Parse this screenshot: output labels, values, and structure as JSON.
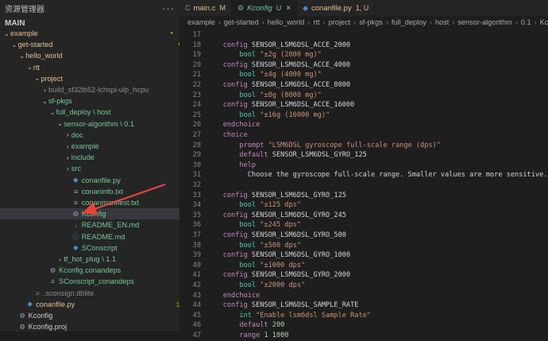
{
  "sidebar": {
    "title": "资源管理器",
    "more": "···",
    "section": "MAIN",
    "rows": [
      {
        "label": "example",
        "indent": 0,
        "chev": "⌄",
        "icon": "",
        "color": "#e2c08d",
        "status": "",
        "sc": "#cca700",
        "dot": true
      },
      {
        "label": "get-started",
        "indent": 1,
        "chev": "⌄",
        "icon": "",
        "color": "#e2c08d",
        "status": "",
        "sc": "#cca700",
        "dot": true
      },
      {
        "label": "hello_world",
        "indent": 2,
        "chev": "⌄",
        "icon": "",
        "color": "#e2c08d",
        "status": "",
        "sc": "#cca700",
        "dot": true
      },
      {
        "label": "rtt",
        "indent": 3,
        "chev": "⌄",
        "icon": "",
        "color": "#e2c08d",
        "status": "",
        "sc": "#cca700",
        "dot": true
      },
      {
        "label": "project",
        "indent": 4,
        "chev": "⌄",
        "icon": "",
        "color": "#e2c08d",
        "status": "",
        "sc": "#cca700",
        "dot": true
      },
      {
        "label": "build_sf32lb52-lchspi-ulp_hcpu",
        "indent": 5,
        "chev": "›",
        "icon": "",
        "color": "#8c8c8c",
        "status": "",
        "sc": "",
        "dot": false
      },
      {
        "label": "sf-pkgs",
        "indent": 5,
        "chev": "⌄",
        "icon": "",
        "color": "#73c991",
        "status": "",
        "sc": "#73c991",
        "dot": true
      },
      {
        "label": "full_deploy \\ host",
        "indent": 6,
        "chev": "⌄",
        "icon": "",
        "color": "#73c991",
        "status": "",
        "sc": "#73c991",
        "dot": true
      },
      {
        "label": "sensor-algorithm \\ 0.1",
        "indent": 7,
        "chev": "⌄",
        "icon": "",
        "color": "#73c991",
        "status": "",
        "sc": "#73c991",
        "dot": true
      },
      {
        "label": "doc",
        "indent": 8,
        "chev": "›",
        "icon": "",
        "color": "#73c991",
        "status": "",
        "sc": "#73c991",
        "dot": true
      },
      {
        "label": "example",
        "indent": 8,
        "chev": "›",
        "icon": "",
        "color": "#73c991",
        "status": "",
        "sc": "#73c991",
        "dot": true
      },
      {
        "label": "include",
        "indent": 8,
        "chev": "›",
        "icon": "",
        "color": "#73c991",
        "status": "",
        "sc": "#73c991",
        "dot": true
      },
      {
        "label": "src",
        "indent": 8,
        "chev": "›",
        "icon": "",
        "color": "#73c991",
        "status": "",
        "sc": "#73c991",
        "dot": true
      },
      {
        "label": "conanfile.py",
        "indent": 8,
        "chev": "",
        "icon": "◆",
        "ic": "#4b8bbe",
        "color": "#73c991",
        "status": "U",
        "sc": "#73c991",
        "dot": false
      },
      {
        "label": "conaninfo.txt",
        "indent": 8,
        "chev": "",
        "icon": "≡",
        "ic": "#9aa4af",
        "color": "#73c991",
        "status": "U",
        "sc": "#73c991",
        "dot": false
      },
      {
        "label": "conanmanifest.txt",
        "indent": 8,
        "chev": "",
        "icon": "≡",
        "ic": "#9aa4af",
        "color": "#73c991",
        "status": "U",
        "sc": "#73c991",
        "dot": false
      },
      {
        "label": "Kconfig",
        "indent": 8,
        "chev": "",
        "icon": "⚙",
        "ic": "#9aa4af",
        "color": "#73c991",
        "status": "U",
        "sc": "#73c991",
        "dot": false,
        "selected": true
      },
      {
        "label": "README_EN.md",
        "indent": 8,
        "chev": "",
        "icon": "↓",
        "ic": "#519aba",
        "color": "#73c991",
        "status": "U",
        "sc": "#73c991",
        "dot": false
      },
      {
        "label": "README.md",
        "indent": 8,
        "chev": "",
        "icon": "ⓘ",
        "ic": "#519aba",
        "color": "#73c991",
        "status": "U",
        "sc": "#73c991",
        "dot": false
      },
      {
        "label": "SConscript",
        "indent": 8,
        "chev": "",
        "icon": "◆",
        "ic": "#4b8bbe",
        "color": "#73c991",
        "status": "U",
        "sc": "#73c991",
        "dot": false
      },
      {
        "label": "tf_hot_plug \\ 1.1",
        "indent": 7,
        "chev": "›",
        "icon": "",
        "color": "#73c991",
        "status": "",
        "sc": "#73c991",
        "dot": true
      },
      {
        "label": "Kconfig.conandeps",
        "indent": 5,
        "chev": "",
        "icon": "⚙",
        "ic": "#9aa4af",
        "color": "#73c991",
        "status": "U",
        "sc": "#73c991",
        "dot": false
      },
      {
        "label": "SConscript_conandeps",
        "indent": 5,
        "chev": "",
        "icon": "≡",
        "ic": "#9aa4af",
        "color": "#73c991",
        "status": "U",
        "sc": "#73c991",
        "dot": false
      },
      {
        "label": ".sconsign.dblite",
        "indent": 3,
        "chev": "",
        "icon": "≡",
        "ic": "#6d8086",
        "color": "#8c8c8c",
        "status": "",
        "sc": "",
        "dot": false
      },
      {
        "label": "conanfile.py",
        "indent": 2,
        "chev": "",
        "icon": "◆",
        "ic": "#4b8bbe",
        "color": "#e2c08d",
        "status": "1, U",
        "sc": "#cca700",
        "dot": false
      },
      {
        "label": "Kconfig",
        "indent": 1,
        "chev": "",
        "icon": "⚙",
        "ic": "#9aa4af",
        "color": "#cccccc",
        "status": "",
        "sc": "",
        "dot": false
      },
      {
        "label": "Kconfig.proj",
        "indent": 1,
        "chev": "",
        "icon": "⚙",
        "ic": "#9aa4af",
        "color": "#cccccc",
        "status": "",
        "sc": "",
        "dot": false
      }
    ]
  },
  "tabs": [
    {
      "icon": "C",
      "ic": "#519aba",
      "label": "main.c",
      "status": "M",
      "color": "#e2c08d",
      "italic": false,
      "active": false
    },
    {
      "icon": "⚙",
      "ic": "#9aa4af",
      "label": "Kconfig",
      "status": "U",
      "color": "#73c991",
      "italic": true,
      "active": true,
      "close": "×"
    },
    {
      "icon": "◆",
      "ic": "#4b8bbe",
      "label": "conanfile.py",
      "status": "1, U",
      "color": "#e2c08d",
      "italic": false,
      "active": false
    }
  ],
  "breadcrumbs": [
    "example",
    "get-started",
    "hello_world",
    "rtt",
    "project",
    "sf-pkgs",
    "full_deploy",
    "host",
    "sensor-algorithm",
    "0.1",
    "Kconfig"
  ],
  "code": {
    "first_line": 17,
    "lines": [
      [],
      [
        [
          "kw",
          "    config "
        ],
        [
          "id",
          "SENSOR_LSM6DSL_ACCE_2000"
        ]
      ],
      [
        [
          "ty",
          "        bool "
        ],
        [
          "str",
          "\"±2g (2000 mg)\""
        ]
      ],
      [
        [
          "kw",
          "    config "
        ],
        [
          "id",
          "SENSOR_LSM6DSL_ACCE_4000"
        ]
      ],
      [
        [
          "ty",
          "        bool "
        ],
        [
          "str",
          "\"±4g (4000 mg)\""
        ]
      ],
      [
        [
          "kw",
          "    config "
        ],
        [
          "id",
          "SENSOR_LSM6DSL_ACCE_8000"
        ]
      ],
      [
        [
          "ty",
          "        bool "
        ],
        [
          "str",
          "\"±8g (8000 mg)\""
        ]
      ],
      [
        [
          "kw",
          "    config "
        ],
        [
          "id",
          "SENSOR_LSM6DSL_ACCE_16000"
        ]
      ],
      [
        [
          "ty",
          "        bool "
        ],
        [
          "str",
          "\"±16g (16000 mg)\""
        ]
      ],
      [
        [
          "kw",
          "    endchoice"
        ]
      ],
      [
        [
          "kw",
          "    choice"
        ]
      ],
      [
        [
          "kw",
          "        prompt "
        ],
        [
          "str",
          "\"LSM6DSL gyroscope full-scale range (dps)\""
        ]
      ],
      [
        [
          "kw",
          "        default "
        ],
        [
          "id",
          "SENSOR_LSM6DSL_GYRO_125"
        ]
      ],
      [
        [
          "kw",
          "        help"
        ]
      ],
      [
        [
          "pl",
          "          Choose the gyroscope full-scale range. Smaller values are more sensitive."
        ]
      ],
      [],
      [
        [
          "kw",
          "    config "
        ],
        [
          "id",
          "SENSOR_LSM6DSL_GYRO_125"
        ]
      ],
      [
        [
          "ty",
          "        bool "
        ],
        [
          "str",
          "\"±125 dps\""
        ]
      ],
      [
        [
          "kw",
          "    config "
        ],
        [
          "id",
          "SENSOR_LSM6DSL_GYRO_245"
        ]
      ],
      [
        [
          "ty",
          "        bool "
        ],
        [
          "str",
          "\"±245 dps\""
        ]
      ],
      [
        [
          "kw",
          "    config "
        ],
        [
          "id",
          "SENSOR_LSM6DSL_GYRO_500"
        ]
      ],
      [
        [
          "ty",
          "        bool "
        ],
        [
          "str",
          "\"±500 dps\""
        ]
      ],
      [
        [
          "kw",
          "    config "
        ],
        [
          "id",
          "SENSOR_LSM6DSL_GYRO_1000"
        ]
      ],
      [
        [
          "ty",
          "        bool "
        ],
        [
          "str",
          "\"±1000 dps\""
        ]
      ],
      [
        [
          "kw",
          "    config "
        ],
        [
          "id",
          "SENSOR_LSM6DSL_GYRO_2000"
        ]
      ],
      [
        [
          "ty",
          "        bool "
        ],
        [
          "str",
          "\"±2000 dps\""
        ]
      ],
      [
        [
          "kw",
          "    endchoice"
        ]
      ],
      [
        [
          "kw",
          "    config "
        ],
        [
          "id",
          "SENSOR_LSM6DSL_SAMPLE_RATE"
        ]
      ],
      [
        [
          "ty",
          "        int "
        ],
        [
          "str",
          "\"Enable lsm6dsl Sample Rate\""
        ]
      ],
      [
        [
          "kw",
          "        default "
        ],
        [
          "nm",
          "200"
        ]
      ],
      [
        [
          "kw",
          "        range "
        ],
        [
          "nm",
          "1 1000"
        ]
      ]
    ]
  }
}
